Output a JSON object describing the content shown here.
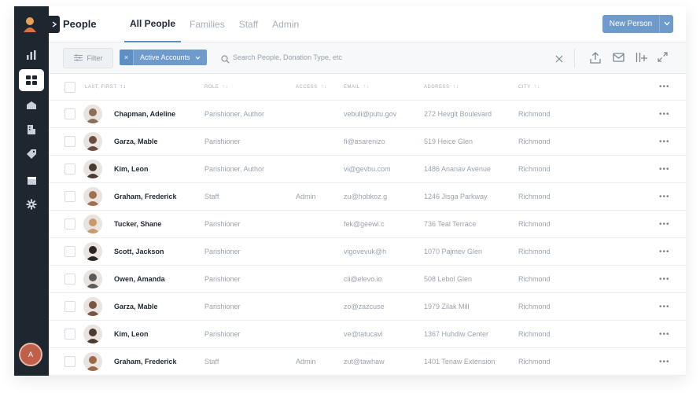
{
  "colors": {
    "sidebar": "#1e2630",
    "accent": "#6e9bcb",
    "active_tab_underline": "#5b8dc4",
    "avatar_bg": "#c0604a"
  },
  "sidebar": {
    "items": [
      {
        "icon": "logo-person-icon"
      },
      {
        "icon": "bar-chart-icon"
      },
      {
        "icon": "people-grid-icon",
        "active": true
      },
      {
        "icon": "inbox-icon"
      },
      {
        "icon": "building-icon"
      },
      {
        "icon": "tag-icon"
      },
      {
        "icon": "calendar-icon"
      },
      {
        "icon": "settings-gear-icon"
      }
    ],
    "user_initial": "A"
  },
  "header": {
    "title": "People",
    "tabs": [
      {
        "label": "All People",
        "active": true
      },
      {
        "label": "Families",
        "active": false
      },
      {
        "label": "Staff",
        "active": false
      },
      {
        "label": "Admin",
        "active": false
      }
    ],
    "new_button_label": "New Person"
  },
  "toolbar": {
    "filter_label": "Filter",
    "chip_label": "Active Accounts",
    "chip_remove": "×",
    "search_placeholder": "Search People, Donation Type, etc",
    "clear": "×"
  },
  "table": {
    "columns": [
      {
        "label": "Last, First",
        "sorted": true
      },
      {
        "label": "Role"
      },
      {
        "label": "Access"
      },
      {
        "label": "Email"
      },
      {
        "label": "Address"
      },
      {
        "label": "City"
      }
    ],
    "more": "•••",
    "rows": [
      {
        "name": "Chapman, Adeline",
        "role": "Parishioner, Author",
        "access": "",
        "email": "vebuli@putu.gov",
        "address": "272 Hevgit Boulevard",
        "city": "Richmond"
      },
      {
        "name": "Garza, Mable",
        "role": "Parishioner",
        "access": "",
        "email": "fi@asarenizo",
        "address": "519 Heice Glen",
        "city": "Richmond"
      },
      {
        "name": "Kim, Leon",
        "role": "Parishioner, Author",
        "access": "",
        "email": "vi@gevbu.com",
        "address": "1486 Ananav Avenue",
        "city": "Richmond"
      },
      {
        "name": "Graham, Frederick",
        "role": "Staff",
        "access": "Admin",
        "email": "zu@hobkoz.g",
        "address": "1246 Jisga Parkway",
        "city": "Richmond"
      },
      {
        "name": "Tucker, Shane",
        "role": "Parishioner",
        "access": "",
        "email": "fek@geewi.c",
        "address": "736 Teal Terrace",
        "city": "Richmond"
      },
      {
        "name": "Scott, Jackson",
        "role": "Parishioner",
        "access": "",
        "email": "vigovevuk@h",
        "address": "1070 Pajmev Glen",
        "city": "Richmond"
      },
      {
        "name": "Owen, Amanda",
        "role": "Parishioner",
        "access": "",
        "email": "cli@elevo.io",
        "address": "508 Lebol Glen",
        "city": "Richmond"
      },
      {
        "name": "Garza, Mable",
        "role": "Parishioner",
        "access": "",
        "email": "zo@zazcuse",
        "address": "1979 Zilak Mill",
        "city": "Richmond"
      },
      {
        "name": "Kim, Leon",
        "role": "Parishioner",
        "access": "",
        "email": "ve@tatucavi",
        "address": "1367 Huhdiw Center",
        "city": "Richmond"
      },
      {
        "name": "Graham, Frederick",
        "role": "Staff",
        "access": "Admin",
        "email": "zut@tawhaw",
        "address": "1401 Tenaw Extension",
        "city": "Richmond"
      }
    ]
  }
}
